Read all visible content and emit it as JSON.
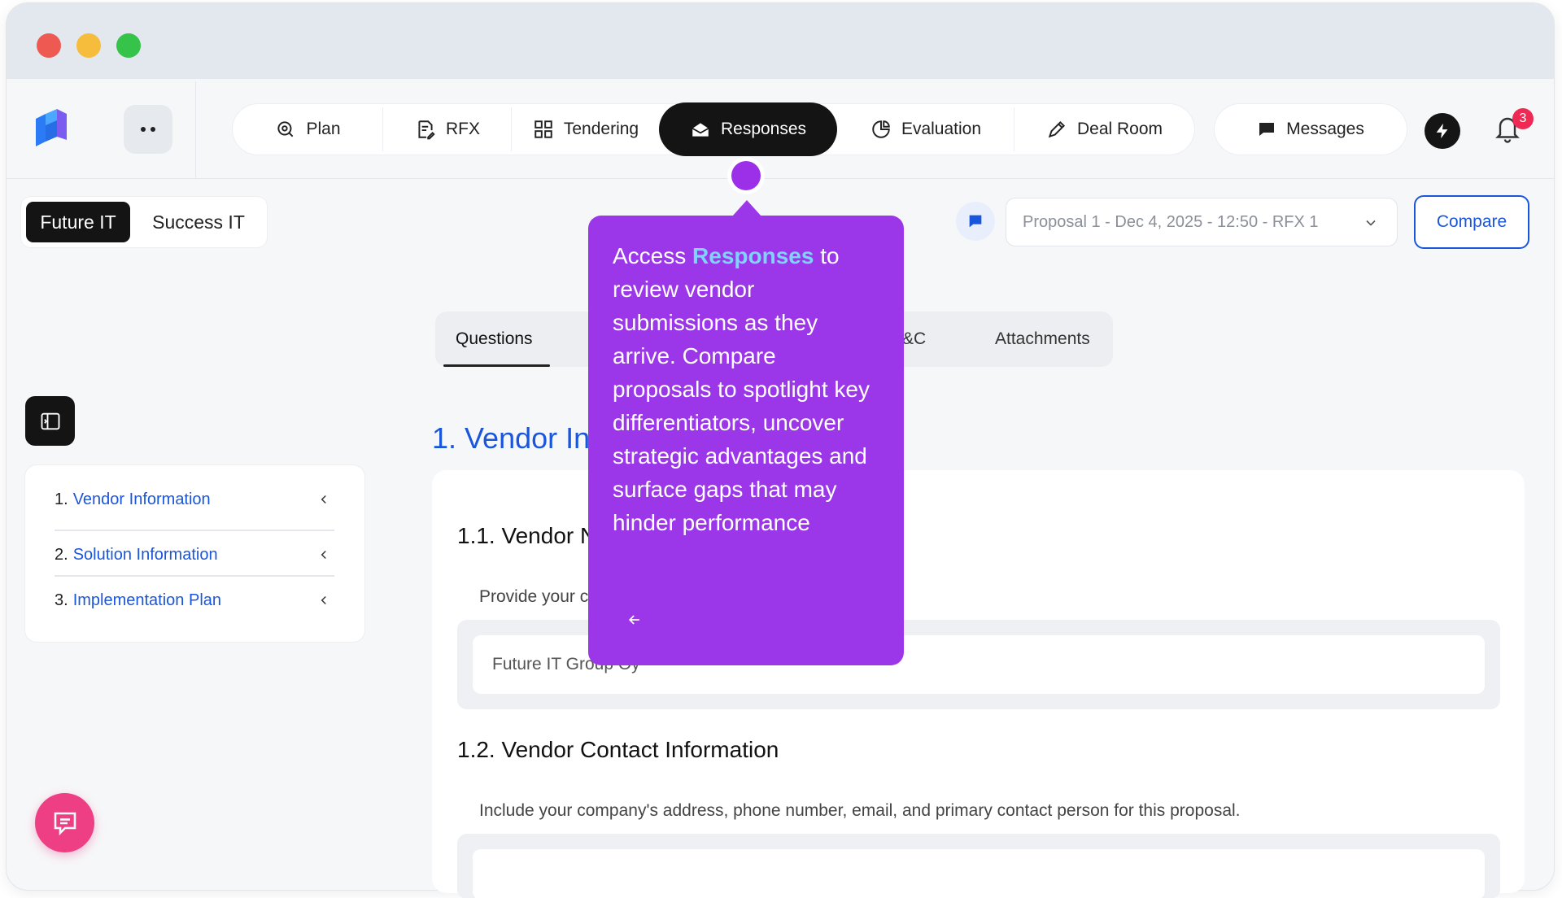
{
  "nav": {
    "tabs": [
      {
        "label": "Plan",
        "icon": "search-scan-icon"
      },
      {
        "label": "RFX",
        "icon": "document-edit-icon"
      },
      {
        "label": "Tendering",
        "icon": "grid-icon"
      },
      {
        "label": "Responses",
        "icon": "inbox-open-icon",
        "active": true
      },
      {
        "label": "Evaluation",
        "icon": "pie-chart-icon"
      },
      {
        "label": "Deal Room",
        "icon": "pen-icon"
      }
    ],
    "messages_label": "Messages",
    "notification_count": "3"
  },
  "vendors": {
    "active": "Future IT",
    "inactive": "Success IT"
  },
  "proposal": {
    "selected": "Proposal 1 - Dec 4, 2025 - 12:50 - RFX 1",
    "compare_label": "Compare"
  },
  "content_tabs": {
    "questions": "Questions",
    "tc_partial": "&C",
    "attachments": "Attachments"
  },
  "toc": [
    {
      "num": "1.",
      "label": "Vendor Information"
    },
    {
      "num": "2.",
      "label": "Solution Information"
    },
    {
      "num": "3.",
      "label": "Implementation Plan"
    }
  ],
  "main": {
    "section_title": "1. Vendor Inf",
    "q1_title": "1.1. Vendor N",
    "q1_desc": "Provide your c",
    "q1_answer": "Future IT Group Oy",
    "q2_title": "1.2. Vendor Contact Information",
    "q2_desc": "Include your company's address, phone number, email, and primary contact person for this proposal."
  },
  "tooltip": {
    "prefix": "Access ",
    "highlight": "Responses",
    "body": " to review vendor submissions as they arrive. Compare proposals to spotlight key differentiators, uncover strategic advantages and surface gaps that may hinder performance"
  },
  "colors": {
    "accent": "#1a56db",
    "tooltip_bg": "#9b37e9",
    "tooltip_highlight": "#7fd4ff",
    "fab": "#ef3f84",
    "badge": "#ee2a54"
  }
}
